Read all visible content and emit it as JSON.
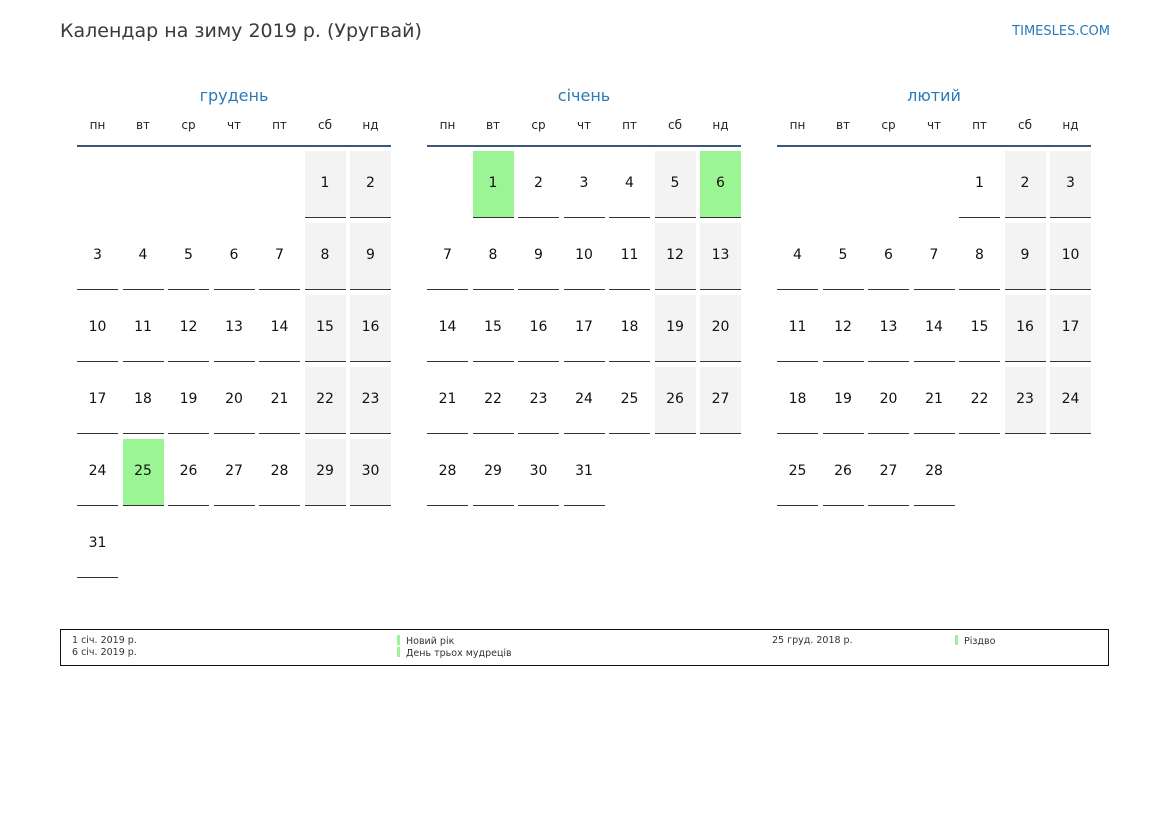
{
  "header": {
    "title": "Календар на зиму 2019 р. (Уругвай)",
    "site": "TIMESLES.COM"
  },
  "colors": {
    "accent": "#2a7ab8",
    "weekend": "#f3f3f3",
    "holiday": "#9cf594",
    "header_rule": "#3c5675"
  },
  "weekdays": [
    "пн",
    "вт",
    "ср",
    "чт",
    "пт",
    "сб",
    "нд"
  ],
  "months": [
    {
      "name": "грудень",
      "offset": 5,
      "days_in_month": 31,
      "holidays": [
        25
      ]
    },
    {
      "name": "січень",
      "offset": 1,
      "days_in_month": 31,
      "holidays": [
        1,
        6
      ]
    },
    {
      "name": "лютий",
      "offset": 4,
      "days_in_month": 28,
      "holidays": []
    }
  ],
  "legend": {
    "left_dates": [
      "1 січ. 2019 р.",
      "6 січ. 2019 р."
    ],
    "left_names": [
      "Новий рік",
      "День трьох мудреців"
    ],
    "right_dates": [
      "25 груд. 2018 р."
    ],
    "right_names": [
      "Різдво"
    ]
  }
}
